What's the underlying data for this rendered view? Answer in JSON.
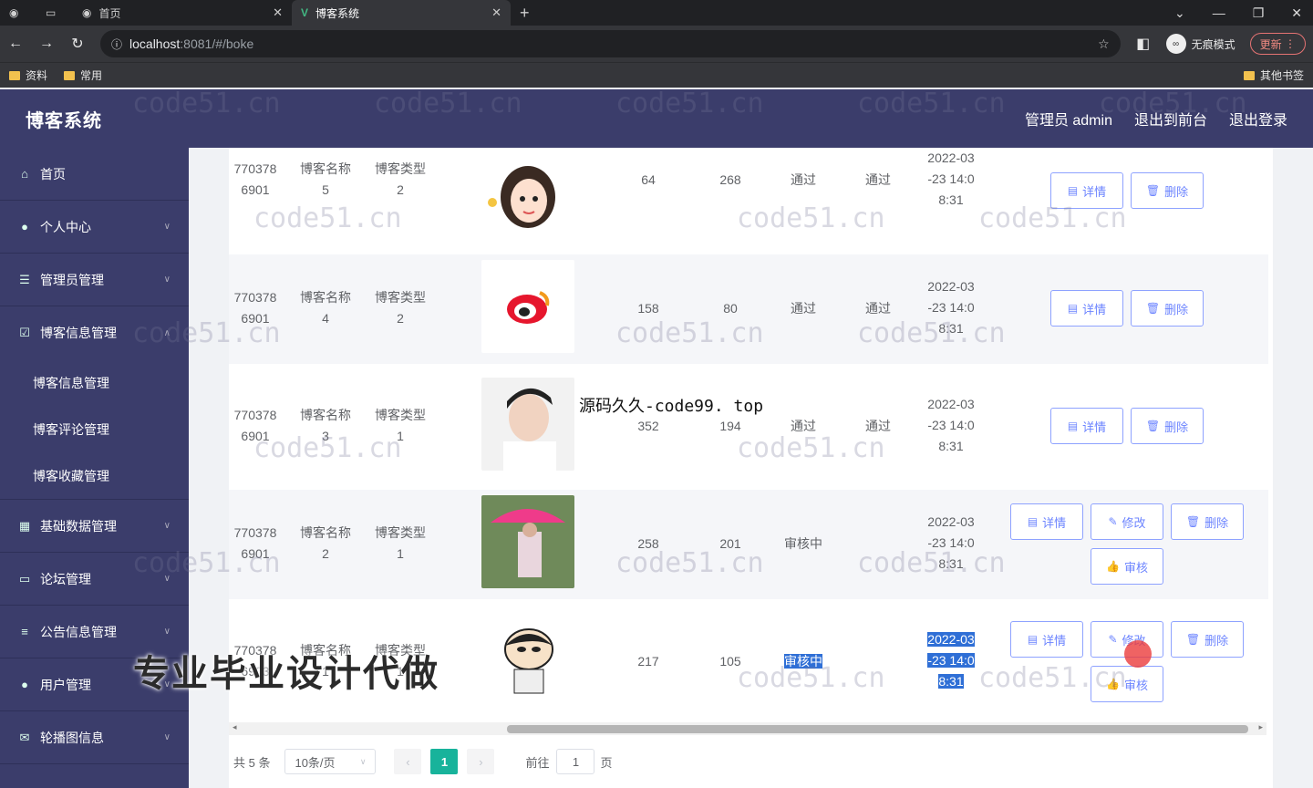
{
  "browser": {
    "tabs": [
      {
        "label": "首页"
      },
      {
        "label": "博客系统"
      }
    ],
    "url_host": "localhost",
    "url_path": ":8081/#/boke",
    "incognito_label": "无痕模式",
    "update_label": "更新",
    "bookmarks": [
      "资料",
      "常用"
    ],
    "other_bookmarks": "其他书签"
  },
  "header": {
    "brand": "博客系统",
    "admin": "管理员 admin",
    "to_front": "退出到前台",
    "logout": "退出登录"
  },
  "sidebar": {
    "items": [
      {
        "label": "首页",
        "icon": "home-icon"
      },
      {
        "label": "个人中心",
        "icon": "user-icon"
      },
      {
        "label": "管理员管理",
        "icon": "sliders-icon"
      },
      {
        "label": "博客信息管理",
        "icon": "check-icon"
      }
    ],
    "sub_items": [
      "博客信息管理",
      "博客评论管理",
      "博客收藏管理"
    ],
    "items_after": [
      {
        "label": "基础数据管理",
        "icon": "grid-icon"
      },
      {
        "label": "论坛管理",
        "icon": "forum-icon"
      },
      {
        "label": "公告信息管理",
        "icon": "list-icon"
      },
      {
        "label": "用户管理",
        "icon": "bulb-icon"
      },
      {
        "label": "轮播图信息",
        "icon": "mail-icon"
      }
    ]
  },
  "table": {
    "rows": [
      {
        "id1": "770378",
        "id2": "6901",
        "name1": "博客名称",
        "name2": "5",
        "type1": "博客类型",
        "type2": "2",
        "v1": "64",
        "v2": "268",
        "s1": "通过",
        "s2": "通过",
        "t1": "2022-03",
        "t2": "-23 14:0",
        "t3": "8:31"
      },
      {
        "id1": "770378",
        "id2": "6901",
        "name1": "博客名称",
        "name2": "4",
        "type1": "博客类型",
        "type2": "2",
        "v1": "158",
        "v2": "80",
        "s1": "通过",
        "s2": "通过",
        "t1": "2022-03",
        "t2": "-23 14:0",
        "t3": "8:31"
      },
      {
        "id1": "770378",
        "id2": "6901",
        "name1": "博客名称",
        "name2": "3",
        "type1": "博客类型",
        "type2": "1",
        "v1": "352",
        "v2": "194",
        "s1": "通过",
        "s2": "通过",
        "t1": "2022-03",
        "t2": "-23 14:0",
        "t3": "8:31"
      },
      {
        "id1": "770378",
        "id2": "6901",
        "name1": "博客名称",
        "name2": "2",
        "type1": "博客类型",
        "type2": "1",
        "v1": "258",
        "v2": "201",
        "s1": "审核中",
        "s2": "",
        "t1": "2022-03",
        "t2": "-23 14:0",
        "t3": "8:31"
      },
      {
        "id1": "770378",
        "id2": "6903",
        "name1": "博客名称",
        "name2": "1",
        "type1": "博客类型",
        "type2": "1",
        "v1": "217",
        "v2": "105",
        "s1": "审核中",
        "s2": "",
        "t1": "2022-03",
        "t2": "-23 14:0",
        "t3": "8:31"
      }
    ],
    "btn_detail": "详情",
    "btn_delete": "删除",
    "btn_edit": "修改",
    "btn_review": "审核"
  },
  "pager": {
    "total": "共 5 条",
    "page_size": "10条/页",
    "current": "1",
    "goto": "前往",
    "goto_value": "1",
    "page_unit": "页"
  },
  "watermark": "code51.cn",
  "overlay": "源码久久-code99. top",
  "promo": "专业毕业设计代做"
}
